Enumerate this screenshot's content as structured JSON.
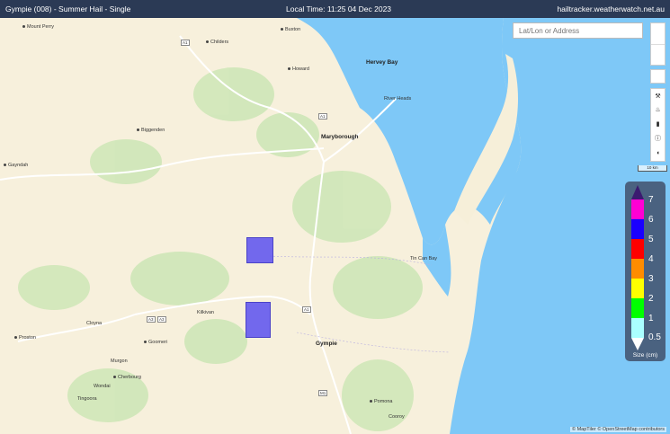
{
  "header": {
    "title": "Gympie (008) - Summer Hail - Single",
    "local_time": "Local Time: 11:25 04 Dec 2023",
    "site": "hailtracker.weatherwatch.net.au"
  },
  "search": {
    "placeholder": "Lat/Lon or Address"
  },
  "zoom": {
    "in": "",
    "out": ""
  },
  "tools": [
    "layers-icon",
    "fire-icon",
    "thermometer-icon",
    "info-icon",
    "gauge-icon"
  ],
  "scale_label": "10 km",
  "legend": {
    "title": "Size (cm)",
    "labels": [
      "7",
      "6",
      "5",
      "4",
      "3",
      "2",
      "1",
      "0.5"
    ],
    "colors": [
      "#ff00d4",
      "#1a00ff",
      "#ff0000",
      "#ff8c00",
      "#ffff00",
      "#00ff00",
      "#aaffff"
    ],
    "arrow_top_color": "#3b1a70",
    "arrow_bottom_color": "#ffffff"
  },
  "places": [
    {
      "name": "Mount Perry",
      "big": false
    },
    {
      "name": "Childers",
      "big": false
    },
    {
      "name": "Buxton",
      "big": false
    },
    {
      "name": "Hervey Bay",
      "big": true
    },
    {
      "name": "Howard",
      "big": false
    },
    {
      "name": "River Heads",
      "big": false
    },
    {
      "name": "Biggenden",
      "big": false
    },
    {
      "name": "Maryborough",
      "big": true
    },
    {
      "name": "Gayndah",
      "big": false
    },
    {
      "name": "Tin Can Bay",
      "big": false
    },
    {
      "name": "Kilkivan",
      "big": false
    },
    {
      "name": "Cloyna",
      "big": false
    },
    {
      "name": "Proston",
      "big": false
    },
    {
      "name": "Goomeri",
      "big": false
    },
    {
      "name": "Gympie",
      "big": true
    },
    {
      "name": "Murgon",
      "big": false
    },
    {
      "name": "Cherbourg",
      "big": false
    },
    {
      "name": "Wondai",
      "big": false
    },
    {
      "name": "Tingoora",
      "big": false
    },
    {
      "name": "Pomona",
      "big": false
    },
    {
      "name": "Cooroy",
      "big": false
    }
  ],
  "roads": [
    "A1",
    "A1",
    "A1",
    "A3",
    "A3",
    "A1",
    "M1"
  ],
  "attribution": "© MapTiler © OpenStreetMap contributors"
}
